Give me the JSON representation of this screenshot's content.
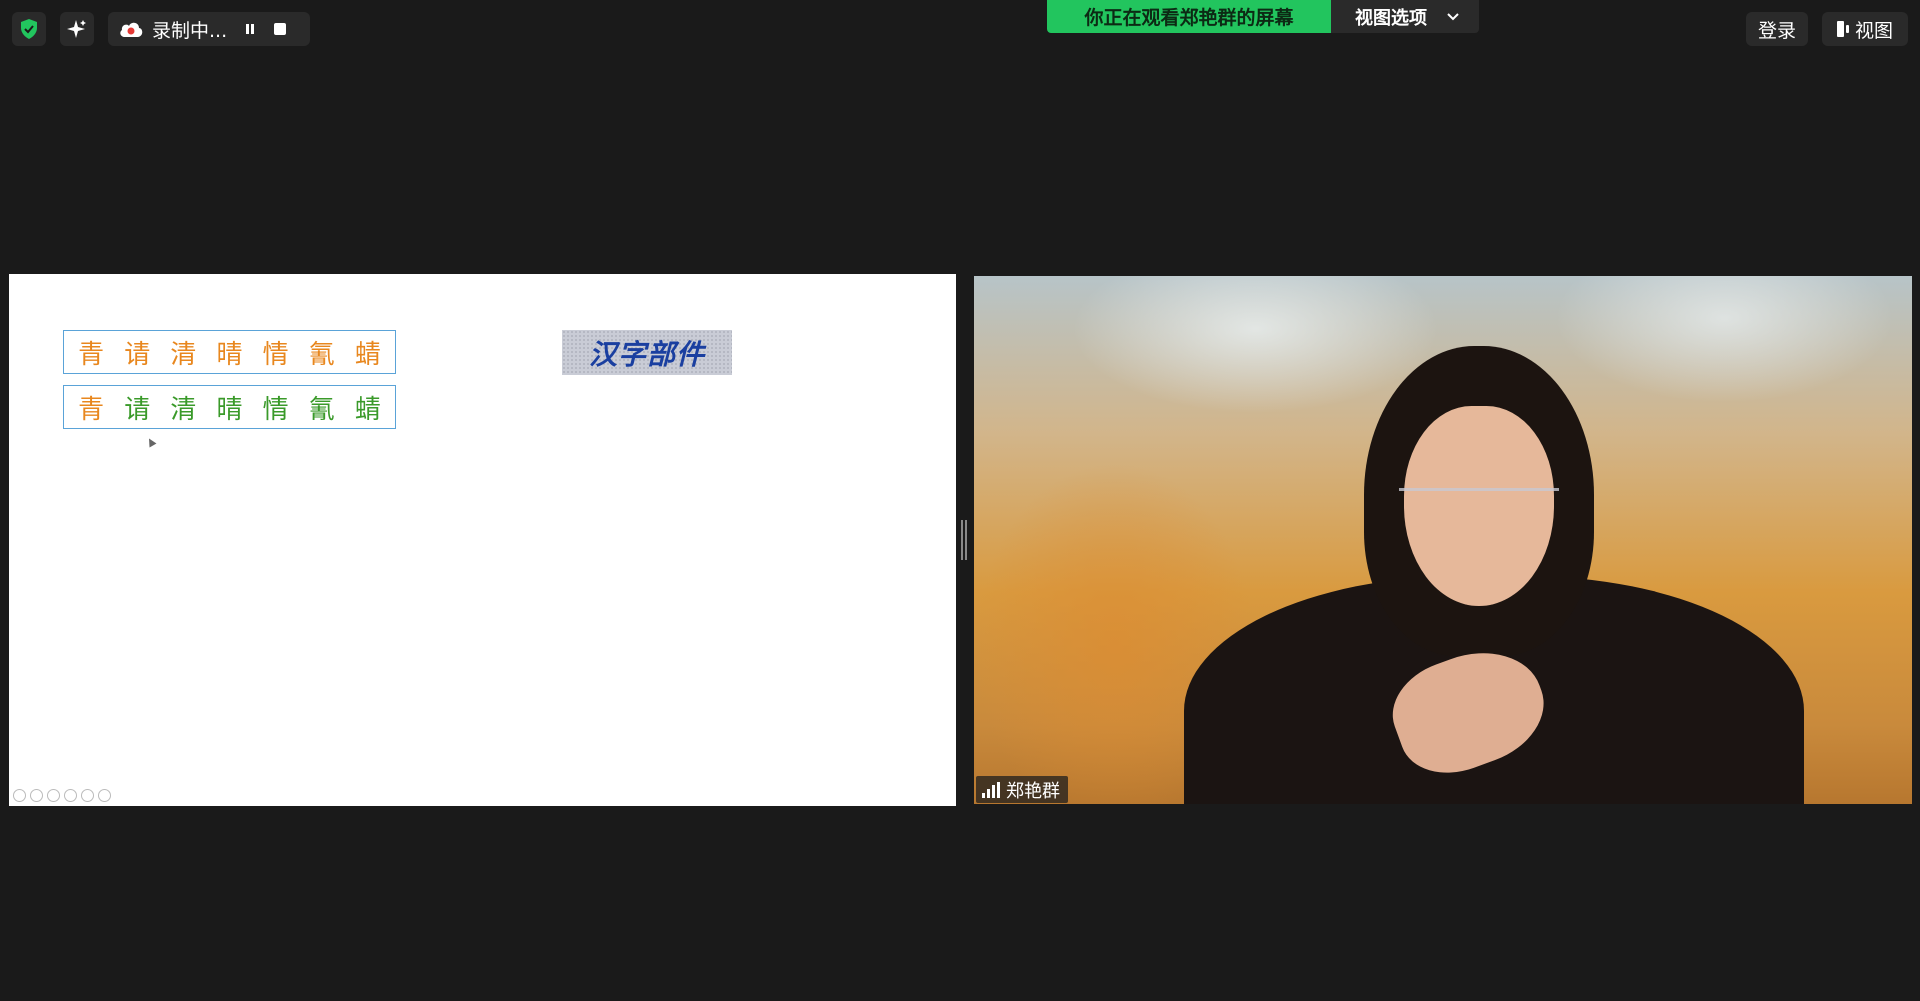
{
  "top_bar": {
    "recording_label": "录制中...",
    "viewing_banner": "你正在观看郑艳群的屏幕",
    "view_options_label": "视图选项",
    "login_label": "登录",
    "view_label": "视图"
  },
  "slide": {
    "row1": [
      "青",
      "请",
      "清",
      "晴",
      "情",
      "氰",
      "蜻"
    ],
    "row2": [
      "青",
      "请",
      "清",
      "晴",
      "情",
      "氰",
      "蜻"
    ],
    "badge_text": "汉字部件"
  },
  "participant": {
    "name": "郑艳群"
  },
  "colors": {
    "banner_green": "#22c55e",
    "char_orange": "#e8871e",
    "char_green": "#3a9a2a",
    "badge_blue": "#1a3fa0"
  }
}
